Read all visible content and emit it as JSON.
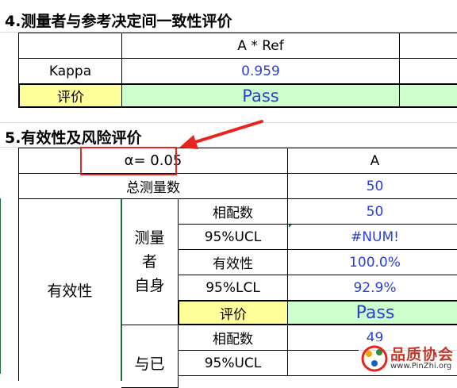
{
  "section4": {
    "title": "4.测量者与参考决定间一致性评价",
    "header_col": "A * Ref",
    "kappa_label": "Kappa",
    "kappa_value": "0.959",
    "eval_label": "评价",
    "eval_value": "Pass"
  },
  "section5": {
    "title": "5.有效性及风险评价",
    "alpha_label": "α= 0.05",
    "col_header": "A",
    "total_label": "总测量数",
    "total_value": "50",
    "effectiveness_label": "有效性",
    "self_group_chars": [
      "测量",
      "者",
      "自身"
    ],
    "self_rows": [
      {
        "label": "相配数",
        "value": "50"
      },
      {
        "label": "95%UCL",
        "value": "#NUM!"
      },
      {
        "label": "有效性",
        "value": "100.0%"
      },
      {
        "label": "95%LCL",
        "value": "92.9%"
      }
    ],
    "self_eval_label": "评价",
    "self_eval_value": "Pass",
    "ref_group_chars": [
      "与已"
    ],
    "ref_rows": [
      {
        "label": "相配数",
        "value": "49"
      },
      {
        "label": "95%UCL",
        "value": ""
      }
    ]
  },
  "watermark": {
    "text": "品质协会",
    "site": "www.PinZhi.org"
  },
  "colors": {
    "value_blue": "#2b3fd6",
    "eval_yellow": "#ffff99",
    "pass_green": "#ccffcc",
    "annotation_red": "#e8241c"
  }
}
